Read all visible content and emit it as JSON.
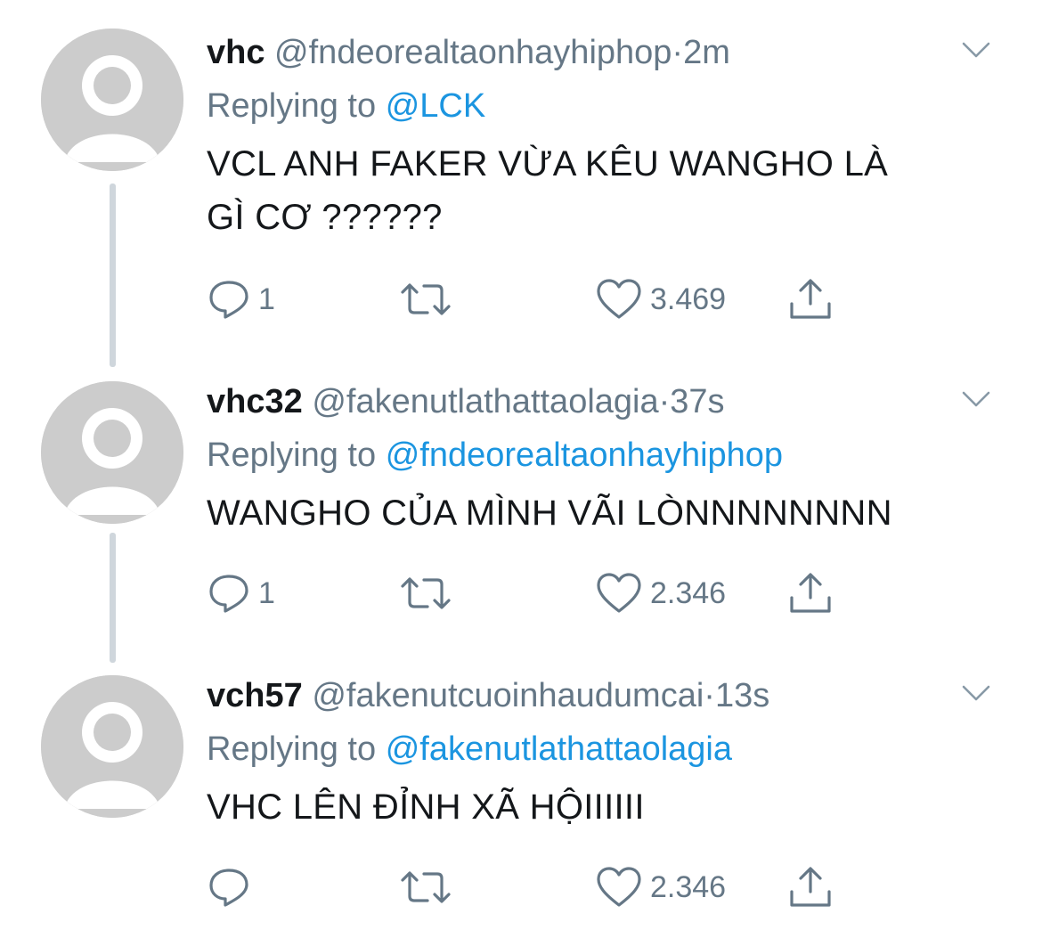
{
  "tweets": [
    {
      "name": "vhc",
      "handle": "@fndeorealtaonhayhiphop",
      "separator": "·",
      "time": "2m",
      "replying_label": "Replying to",
      "replying_to": "@LCK",
      "text_lines": [
        "VCL ANH FAKER VỪA KÊU WANGHO LÀ",
        "GÌ CƠ ??????"
      ],
      "reply_count": "1",
      "retweet_count": "",
      "like_count": "3.469"
    },
    {
      "name": "vhc32",
      "handle": "@fakenutlathattaolagia",
      "separator": "·",
      "time": "37s",
      "replying_label": "Replying to",
      "replying_to": "@fndeorealtaonhayhiphop",
      "text_lines": [
        "WANGHO CỦA MÌNH VÃI LÒNNNNNNNN"
      ],
      "reply_count": "1",
      "retweet_count": "",
      "like_count": "2.346"
    },
    {
      "name": "vch57",
      "handle": "@fakenutcuoinhaudumcai",
      "separator": "·",
      "time": "13s",
      "replying_label": "Replying to",
      "replying_to": "@fakenutlathattaolagia",
      "text_lines": [
        "VHC LÊN ĐỈNH XÃ HỘIIIIII"
      ],
      "reply_count": "",
      "retweet_count": "",
      "like_count": "2.346"
    }
  ],
  "icons": {
    "reply": "reply-icon",
    "retweet": "retweet-icon",
    "like": "heart-icon",
    "share": "share-icon",
    "menu": "chevron-down-icon",
    "avatar": "default-avatar-icon"
  },
  "colors": {
    "text": "#14171a",
    "secondary": "#657786",
    "link": "#1b95e0",
    "avatar_bg": "#cccccc",
    "thread_line": "#cfd6dc"
  }
}
